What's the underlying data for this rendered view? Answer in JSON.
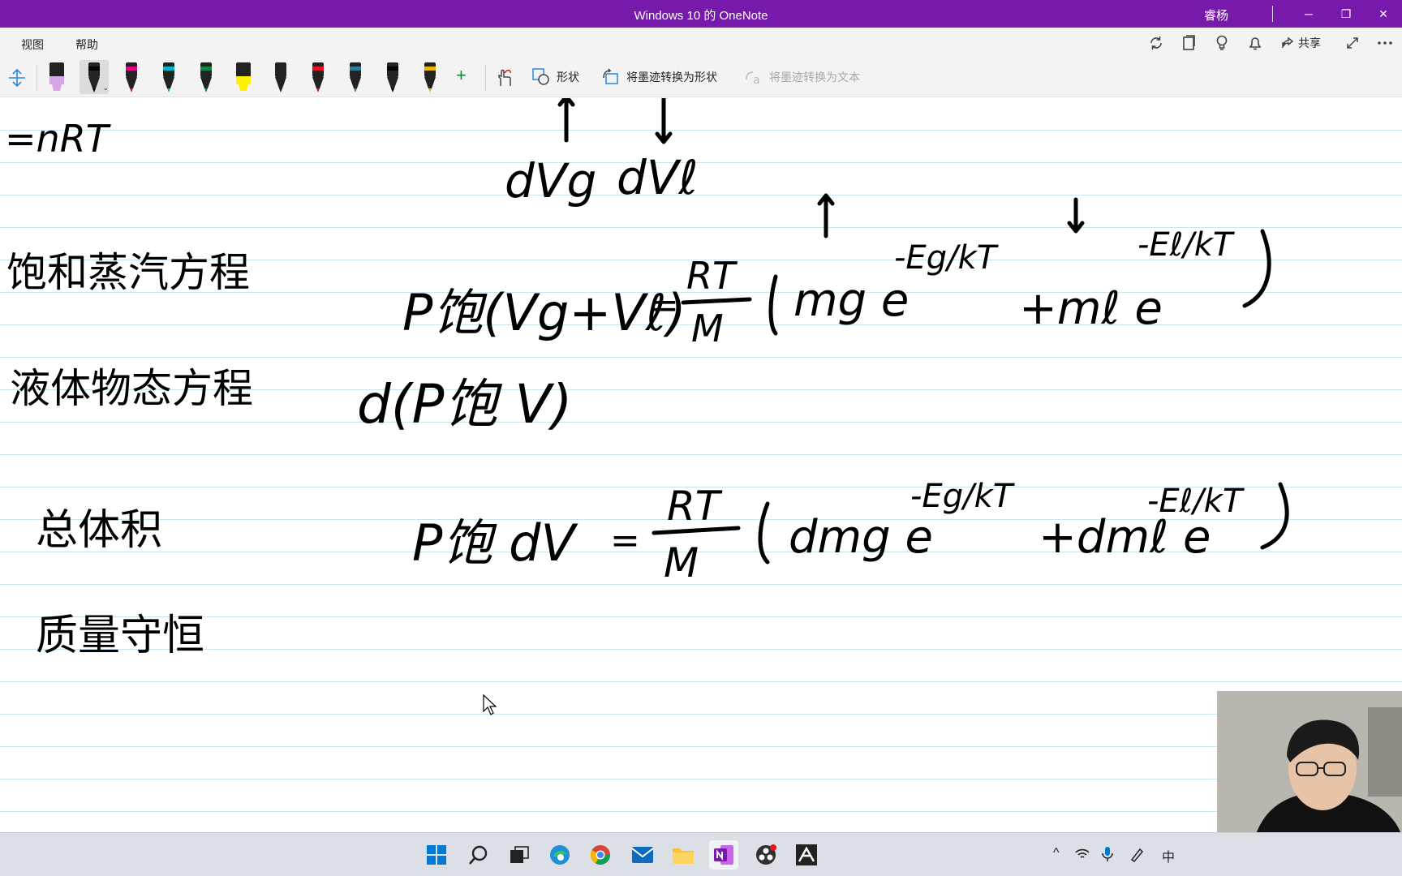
{
  "window": {
    "title": "Windows 10 的 OneNote",
    "user": "睿杨",
    "min": "─",
    "restore": "❐",
    "close": "✕"
  },
  "menu": {
    "view": "视图",
    "help": "帮助",
    "share": "共享"
  },
  "toolbar": {
    "shapes_label": "形状",
    "ink_to_shape_label": "将墨迹转换为形状",
    "ink_to_text_label": "将墨迹转换为文本",
    "add_pen": "+",
    "pens": [
      {
        "name": "highlighter-lavender",
        "color": "#d8a6e6"
      },
      {
        "name": "pen-black-selected",
        "color": "#000000"
      },
      {
        "name": "pen-magenta",
        "color": "#e3008c"
      },
      {
        "name": "pen-cyan",
        "color": "#00b7c3"
      },
      {
        "name": "pen-green",
        "color": "#10893e"
      },
      {
        "name": "highlighter-yellow",
        "color": "#fff100"
      },
      {
        "name": "pen-galaxy",
        "color": "#222222"
      },
      {
        "name": "pen-rainbow",
        "color": "#e81123"
      },
      {
        "name": "pen-ocean",
        "color": "#2d7d9a"
      },
      {
        "name": "pen-black-2",
        "color": "#000000"
      },
      {
        "name": "pen-gold",
        "color": "#e8b800"
      }
    ]
  },
  "notes": {
    "gas_law": "=nRT",
    "dvg": "dVg",
    "dvl": "dVℓ",
    "sat_vapor_eq": "饱和蒸汽方程",
    "sat_eq_lhs": "P饱(Vg+Vℓ)",
    "eq_sign": "=",
    "rt": "RT",
    "m": "M",
    "mg": "mg e",
    "exp_g": "-Eg/kT",
    "ml": "+mℓ e",
    "exp_l": "-Eℓ/kT",
    "liquid_state_eq": "液体物态方程",
    "diff": "d(P饱 V)",
    "total_volume": "总体积",
    "mass_conservation": "质量守恒",
    "lhs2": "P饱 dV",
    "dmg": "dmg e",
    "dml": "+dmℓ e"
  },
  "taskbar": {
    "lang": "中",
    "chevron": "^"
  }
}
